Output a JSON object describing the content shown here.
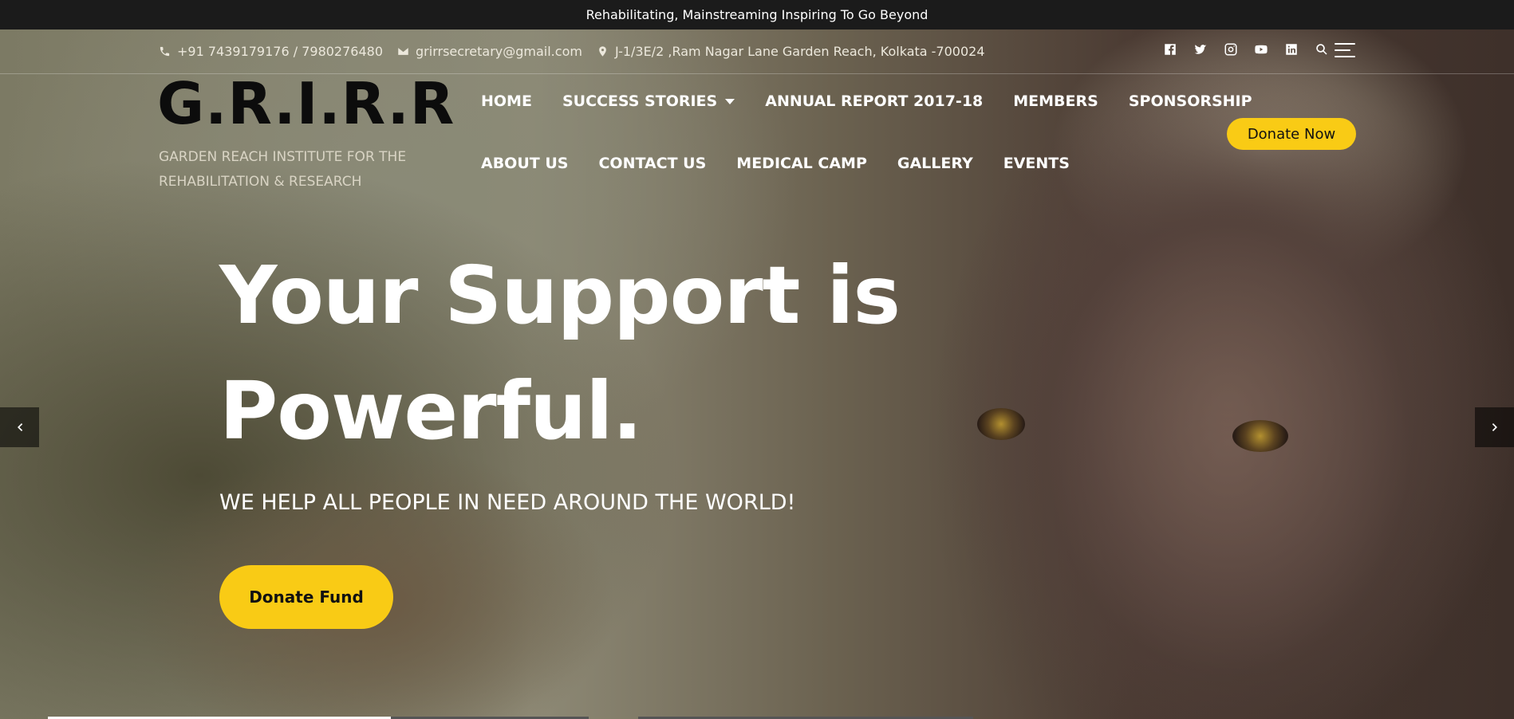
{
  "topbar": {
    "tagline": "Rehabilitating, Mainstreaming Inspiring To Go Beyond"
  },
  "contact": {
    "phone": "+91 7439179176 / 7980276480",
    "email": "grirrsecretary@gmail.com",
    "address": "J-1/3E/2 ,Ram Nagar Lane Garden Reach, Kolkata -700024"
  },
  "social": [
    "facebook-icon",
    "twitter-icon",
    "instagram-icon",
    "youtube-icon",
    "linkedin-icon",
    "search-icon",
    "menu-icon"
  ],
  "brand": {
    "logo": "G.R.I.R.R",
    "tagline": "GARDEN REACH INSTITUTE FOR THE REHABILITATION & RESEARCH"
  },
  "nav": {
    "row1": [
      "HOME",
      "SUCCESS STORIES",
      "ANNUAL REPORT 2017-18",
      "MEMBERS",
      "SPONSORSHIP"
    ],
    "row2": [
      "ABOUT US",
      "CONTACT US",
      "MEDICAL CAMP",
      "GALLERY",
      "EVENTS"
    ],
    "donate_label": "Donate Now"
  },
  "hero": {
    "headline_line1": "Your Support is",
    "headline_line2": "Powerful.",
    "subheading": "WE HELP ALL PEOPLE IN NEED AROUND THE WORLD!",
    "cta_label": "Donate Fund"
  },
  "colors": {
    "accent": "#f9cb15",
    "topbar": "#1b1b1b"
  }
}
